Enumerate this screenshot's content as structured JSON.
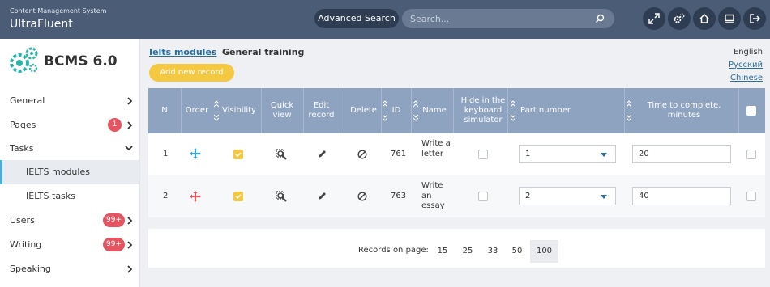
{
  "header": {
    "subtitle": "Content Management System",
    "app_name": "UltraFluent",
    "advanced_search": "Advanced Search",
    "search_placeholder": "Search...",
    "buttons": [
      "expand-icon",
      "gears-icon",
      "home-icon",
      "monitor-icon",
      "logout-icon"
    ]
  },
  "sidebar": {
    "logo_text": "BCMS 6.0",
    "items": [
      {
        "label": "General",
        "badge": ""
      },
      {
        "label": "Pages",
        "badge": "1"
      },
      {
        "label": "Tasks",
        "badge": "",
        "expanded": true
      },
      {
        "label": "IELTS modules",
        "badge": "",
        "active": true
      },
      {
        "label": "IELTS tasks",
        "badge": ""
      },
      {
        "label": "Users",
        "badge": "99+"
      },
      {
        "label": "Writing",
        "badge": "99+"
      },
      {
        "label": "Speaking",
        "badge": ""
      }
    ]
  },
  "breadcrumb": {
    "parent": "Ielts modules",
    "separator": "›",
    "current": "General training"
  },
  "add_button": "Add new record",
  "languages": [
    "English",
    "Русский",
    "Chinese"
  ],
  "table": {
    "headers": {
      "n": "N",
      "order": "Order",
      "visibility": "Visibility",
      "quick_view": "Quick view",
      "edit": "Edit record",
      "delete": "Delete",
      "id": "ID",
      "name": "Name",
      "hide": "Hide in the keyboard simulator",
      "part": "Part number",
      "time": "Time to complete, minutes"
    },
    "rows": [
      {
        "n": "1",
        "id": "761",
        "name": "Write a letter",
        "part": "1",
        "time": "20",
        "move_color": "#3aa8d8"
      },
      {
        "n": "2",
        "id": "763",
        "name": "Write an essay",
        "part": "2",
        "time": "40",
        "move_color": "#e35561"
      }
    ]
  },
  "pager": {
    "label": "Records on page:",
    "options": [
      "15",
      "25",
      "33",
      "50",
      "100"
    ],
    "selected": "100"
  },
  "colors": {
    "header_bg": "#4a5c76",
    "table_header_bg": "#8ea3c0",
    "accent_yellow": "#f5c842",
    "badge_red": "#e35561",
    "link_blue": "#2a6e9e"
  }
}
